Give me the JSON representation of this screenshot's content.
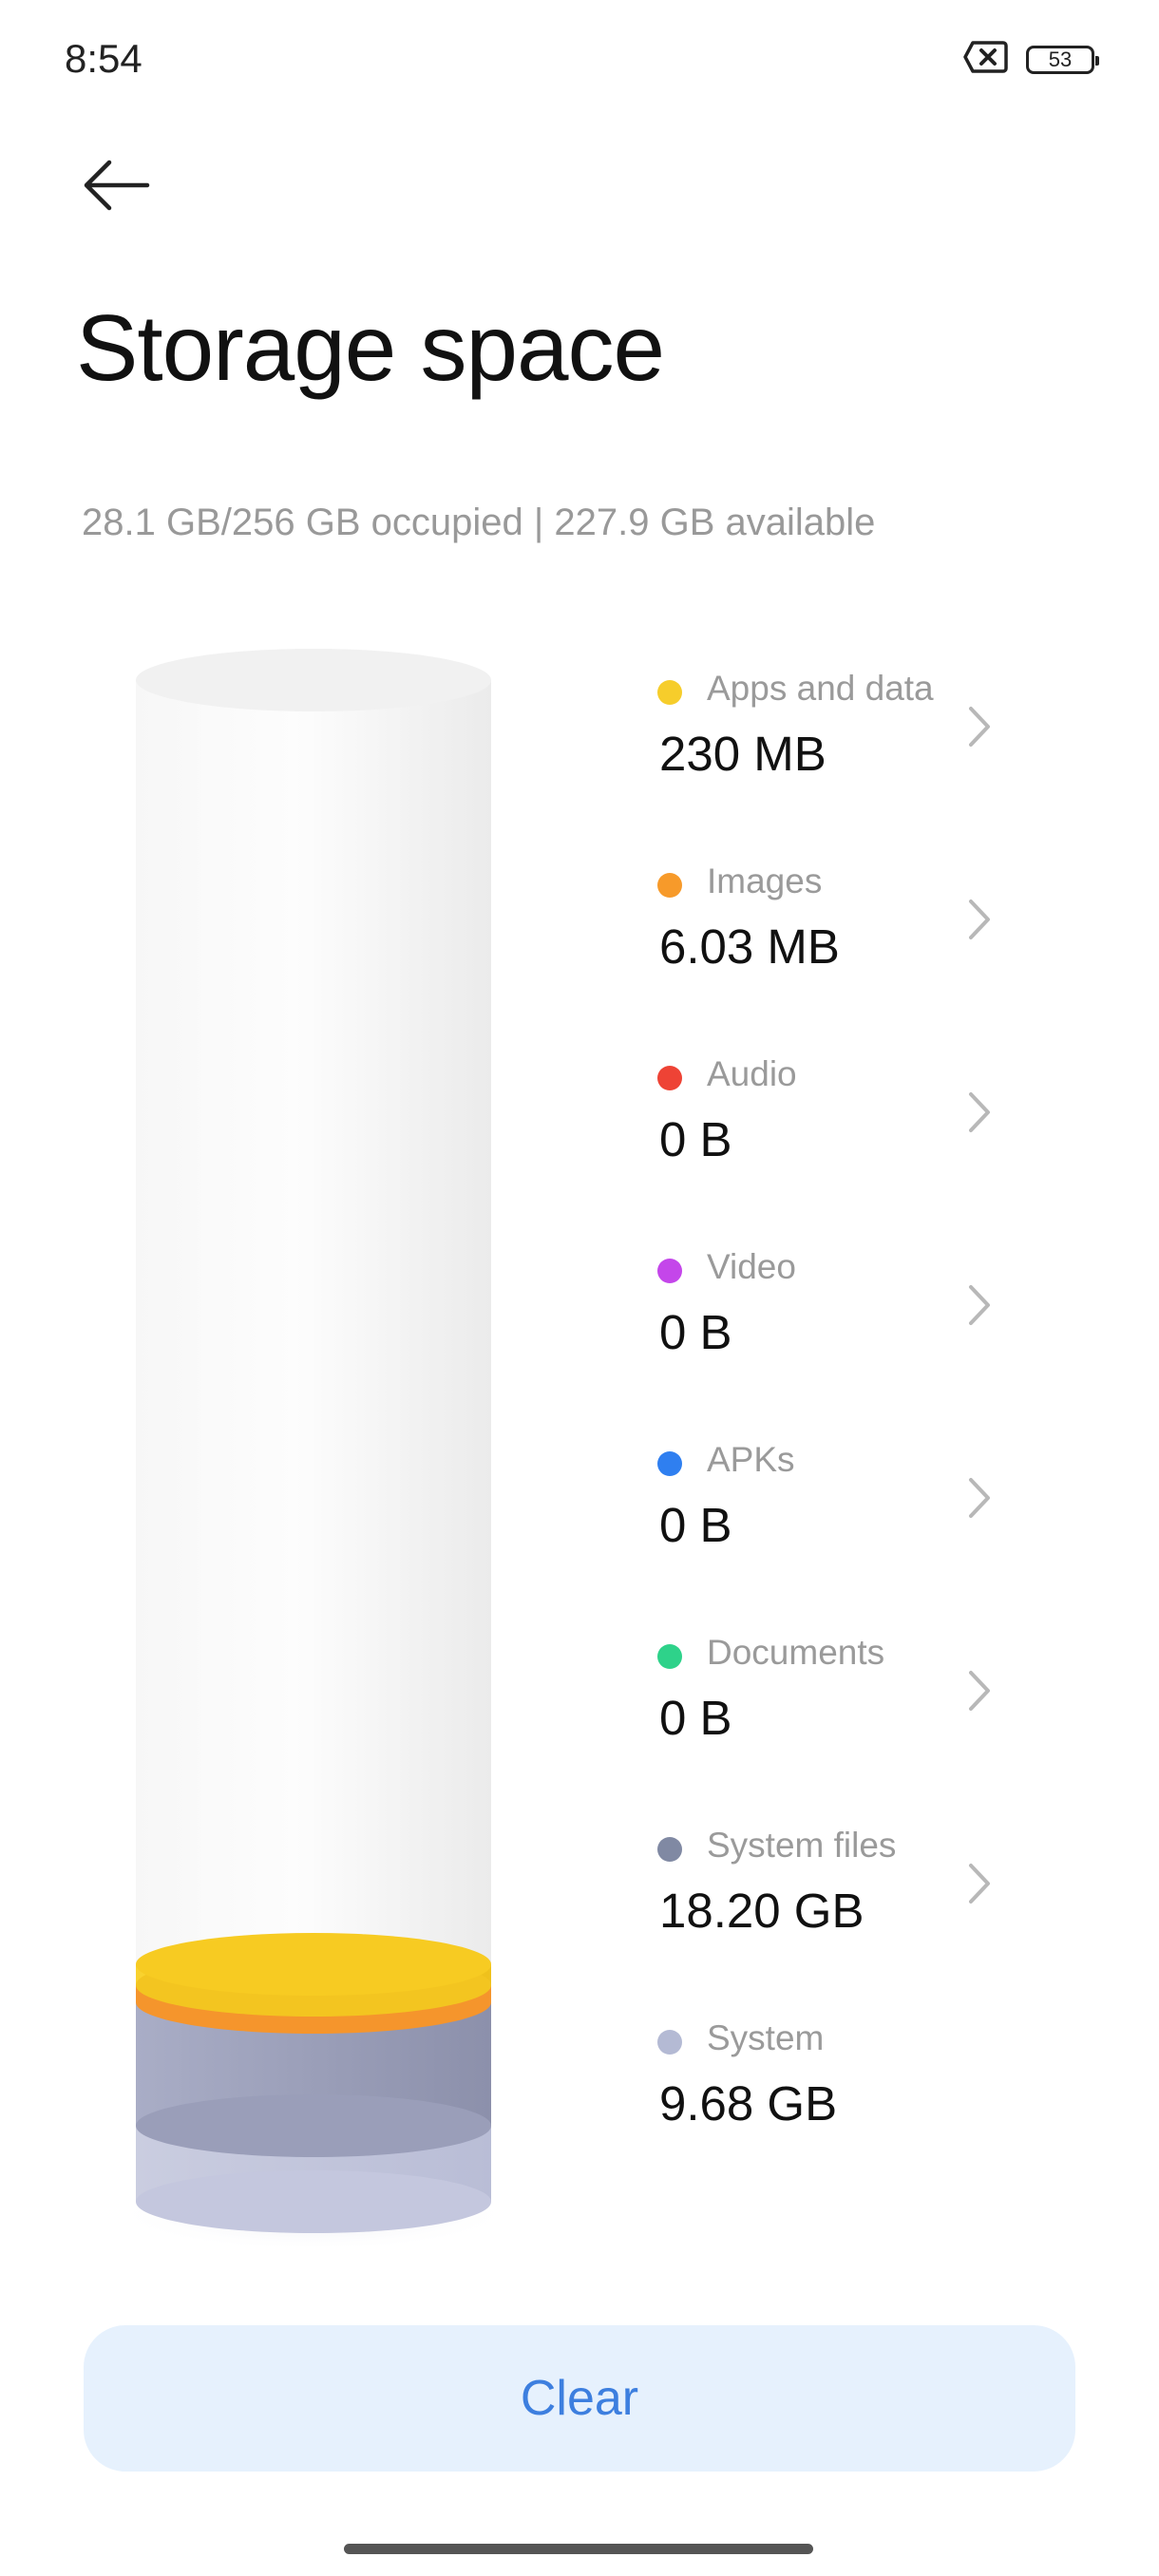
{
  "status_bar": {
    "time": "8:54",
    "battery": "53"
  },
  "header": {
    "title": "Storage space"
  },
  "summary": "28.1 GB/256 GB occupied | 227.9 GB available",
  "categories": [
    {
      "label": "Apps and data",
      "size": "230 MB",
      "color": "#f6cd2b",
      "has_chevron": true
    },
    {
      "label": "Images",
      "size": "6.03 MB",
      "color": "#f79a2a",
      "has_chevron": true
    },
    {
      "label": "Audio",
      "size": "0 B",
      "color": "#ee4335",
      "has_chevron": true
    },
    {
      "label": "Video",
      "size": "0 B",
      "color": "#c446ea",
      "has_chevron": true
    },
    {
      "label": "APKs",
      "size": "0 B",
      "color": "#2f7ff0",
      "has_chevron": true
    },
    {
      "label": "Documents",
      "size": "0 B",
      "color": "#2ed28a",
      "has_chevron": true
    },
    {
      "label": "System files",
      "size": "18.20 GB",
      "color": "#8089a3",
      "has_chevron": true
    },
    {
      "label": "System",
      "size": "9.68 GB",
      "color": "#b4bad4",
      "has_chevron": false
    }
  ],
  "actions": {
    "clear_label": "Clear"
  },
  "icons": {
    "back": "back-arrow-icon",
    "battery": "battery-icon",
    "no_sim": "no-sim-icon",
    "chevron": "chevron-right-icon"
  }
}
